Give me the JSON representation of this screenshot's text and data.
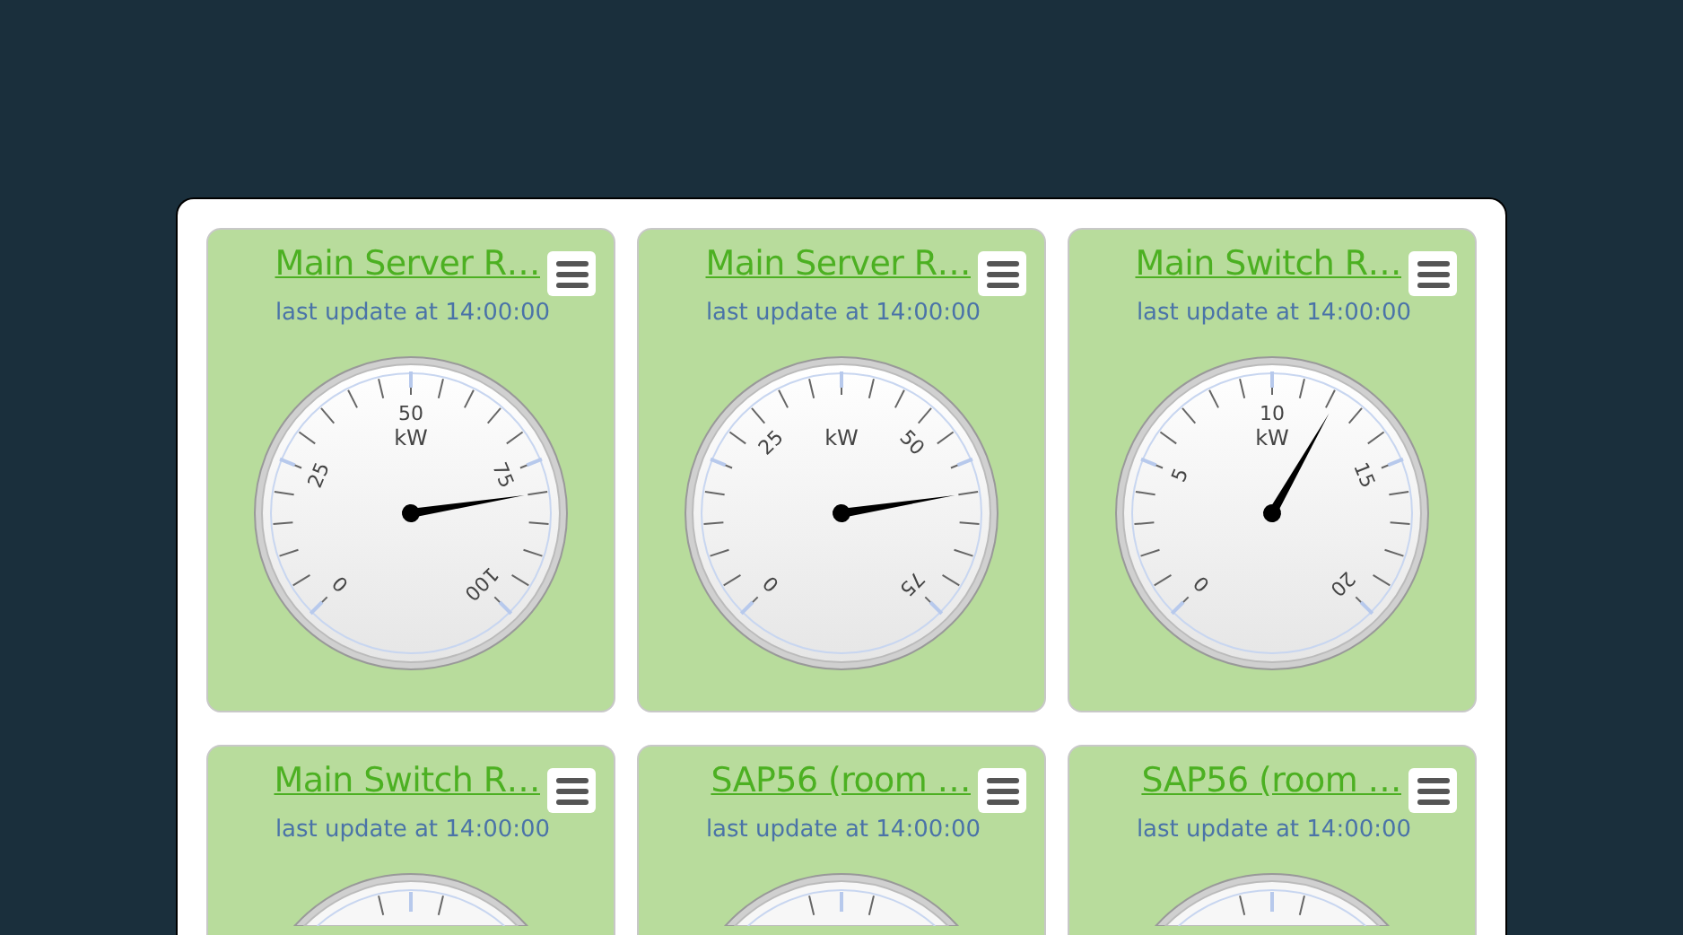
{
  "cards": [
    {
      "title": "Main Server R…",
      "update": "last update at 14:00:00",
      "gauge": {
        "unit": "kW",
        "scale": [
          "0",
          "25",
          "50",
          "75",
          "100"
        ],
        "level": 0.8
      }
    },
    {
      "title": "Main Server R…",
      "update": "last update at 14:00:00",
      "gauge": {
        "unit": "kW",
        "scale": [
          "0",
          "25",
          "50",
          "75"
        ],
        "level": 0.8
      }
    },
    {
      "title": "Main Switch R…",
      "update": "last update at 14:00:00",
      "gauge": {
        "unit": "kW",
        "scale": [
          "0",
          "5",
          "10",
          "15",
          "20"
        ],
        "level": 0.61
      }
    },
    {
      "title": "Main Switch R…",
      "update": "last update at 14:00:00"
    },
    {
      "title": "SAP56 (room …",
      "update": "last update at 14:00:00"
    },
    {
      "title": "SAP56 (room …",
      "update": "last update at 14:00:00"
    }
  ]
}
